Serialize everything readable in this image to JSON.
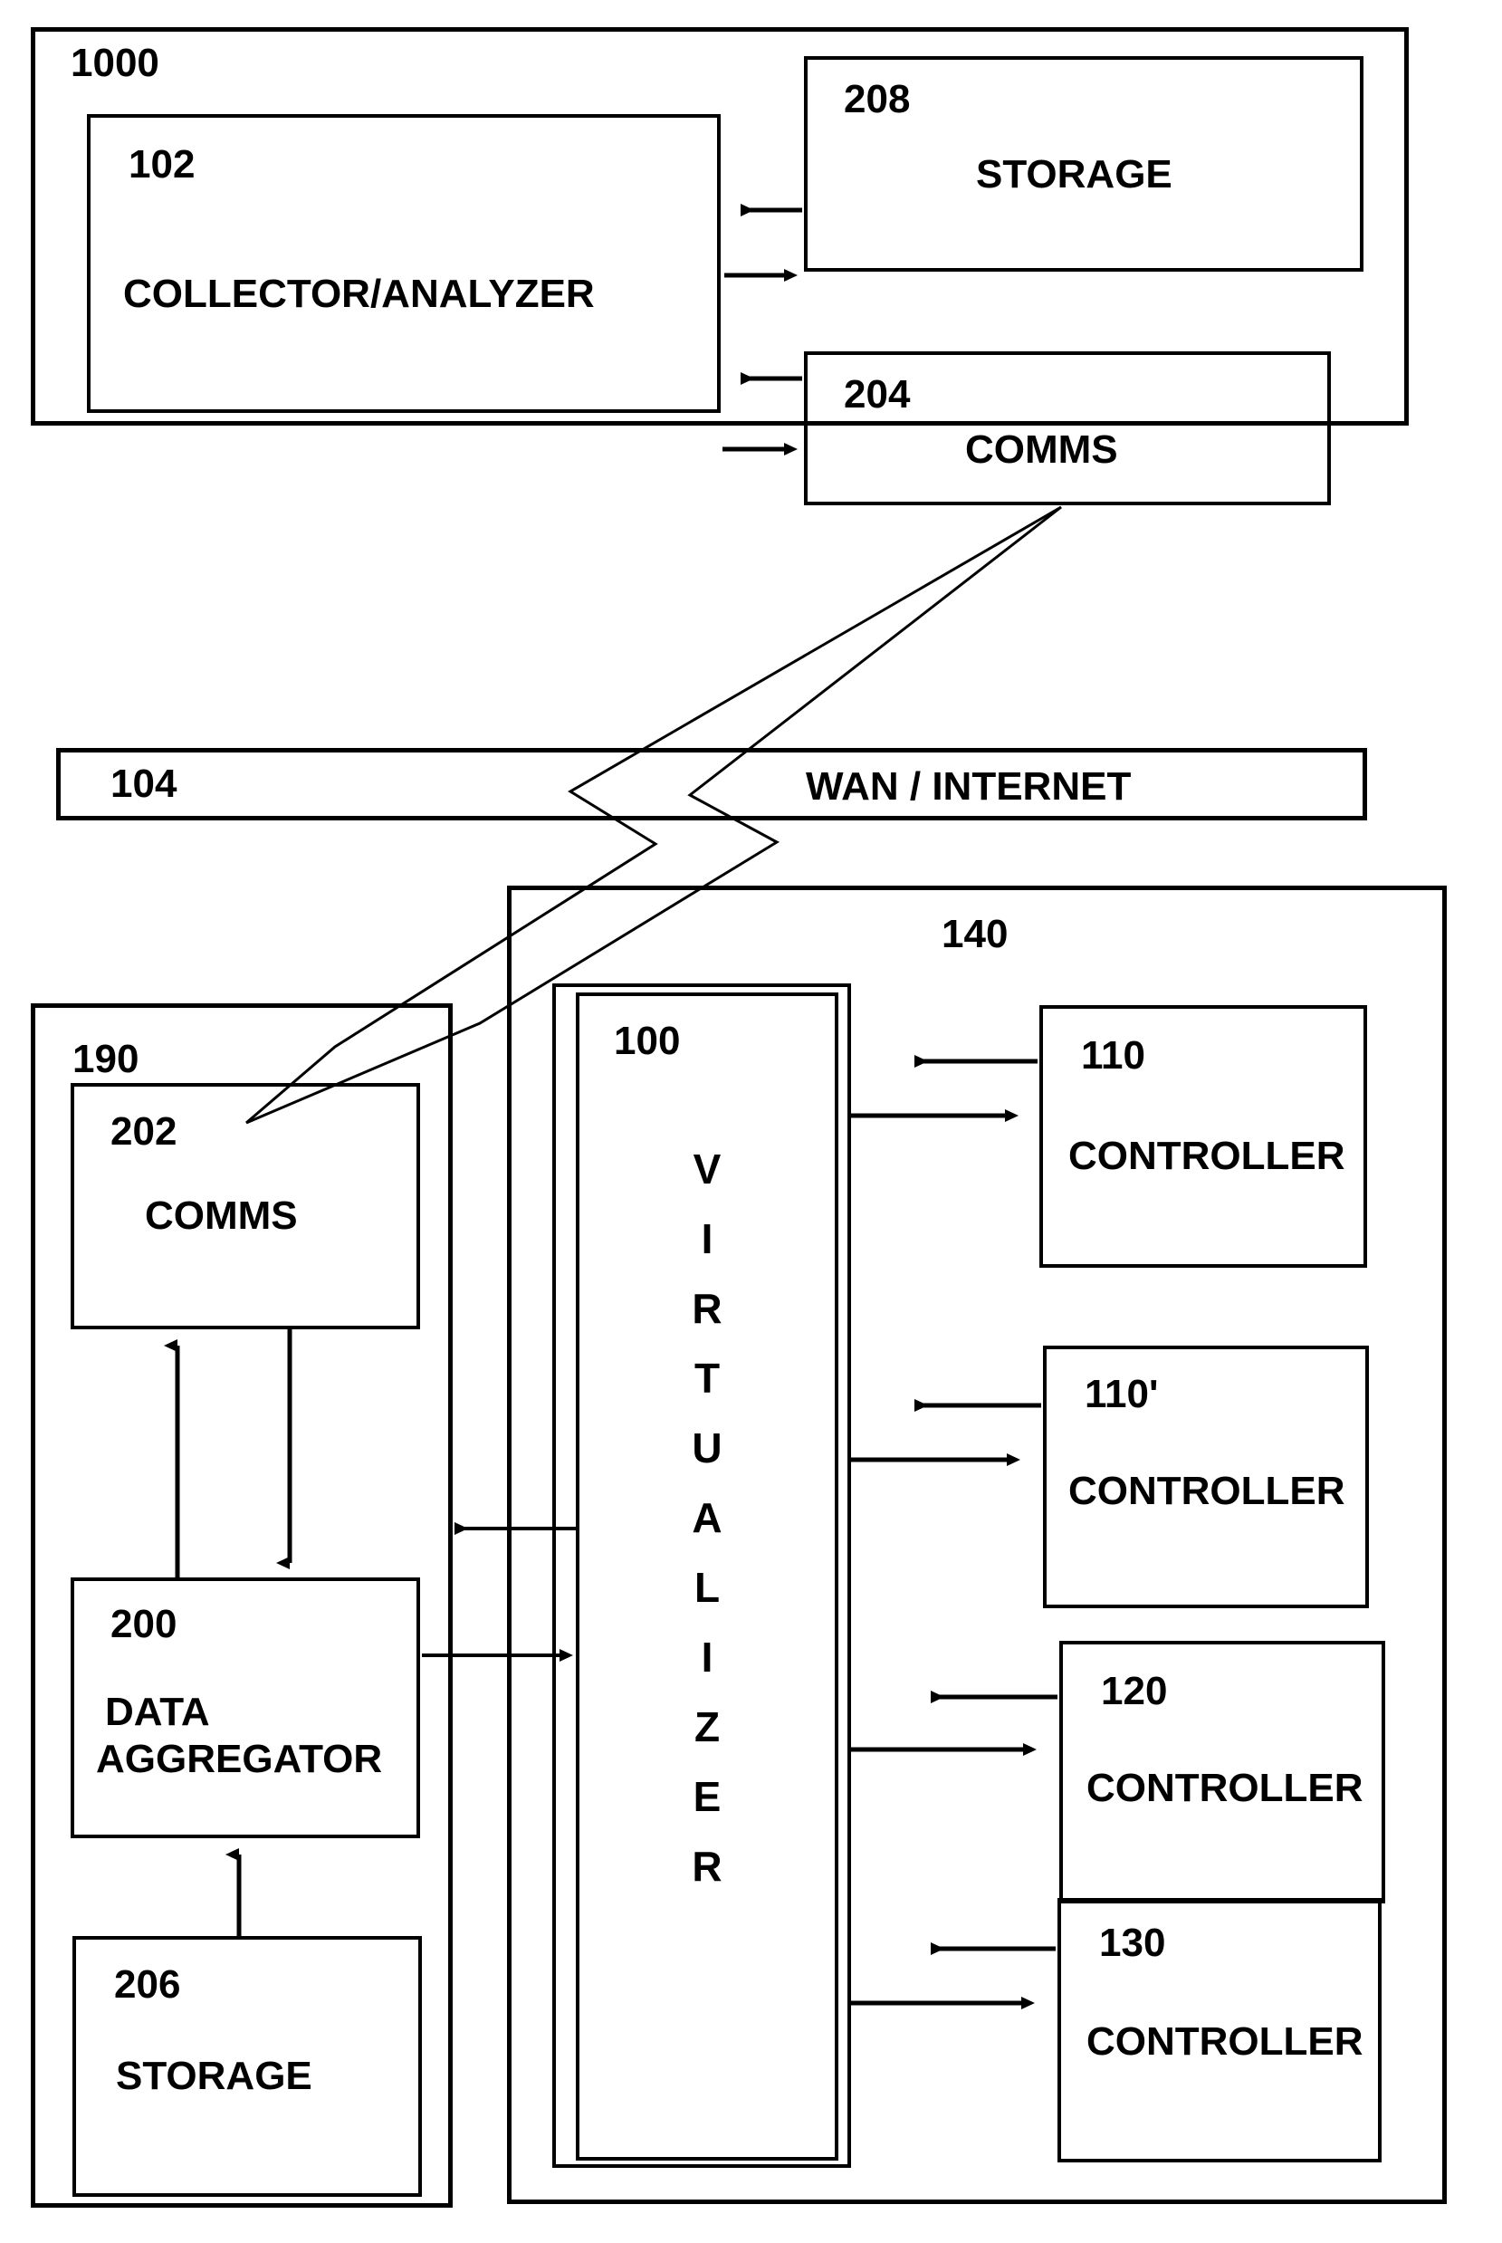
{
  "figure": {
    "type": "patent-block-diagram",
    "background": "#ffffff",
    "line_color": "#000000"
  },
  "top_panel": {
    "ref": "1000",
    "blocks": [
      {
        "ref": "102",
        "label": "COLLECTOR/ANALYZER"
      },
      {
        "ref": "208",
        "label": "STORAGE"
      },
      {
        "ref": "204",
        "label": "COMMS"
      }
    ]
  },
  "network": {
    "ref": "104",
    "label": "WAN / INTERNET"
  },
  "left_panel": {
    "ref": "190",
    "blocks": [
      {
        "ref": "202",
        "label": "COMMS"
      },
      {
        "ref": "200",
        "label_line1": "DATA",
        "label_line2": "AGGREGATOR"
      },
      {
        "ref": "206",
        "label": "STORAGE"
      }
    ]
  },
  "right_panel": {
    "ref": "140",
    "virtualizer": {
      "ref": "100",
      "label": "VIRTUALIZER",
      "letters": [
        "V",
        "I",
        "R",
        "T",
        "U",
        "A",
        "L",
        "I",
        "Z",
        "E",
        "R"
      ]
    },
    "controllers": [
      {
        "ref": "110",
        "label": "CONTROLLER"
      },
      {
        "ref": "110'",
        "label": "CONTROLLER"
      },
      {
        "ref": "120",
        "label": "CONTROLLER"
      },
      {
        "ref": "130",
        "label": "CONTROLLER"
      }
    ]
  }
}
